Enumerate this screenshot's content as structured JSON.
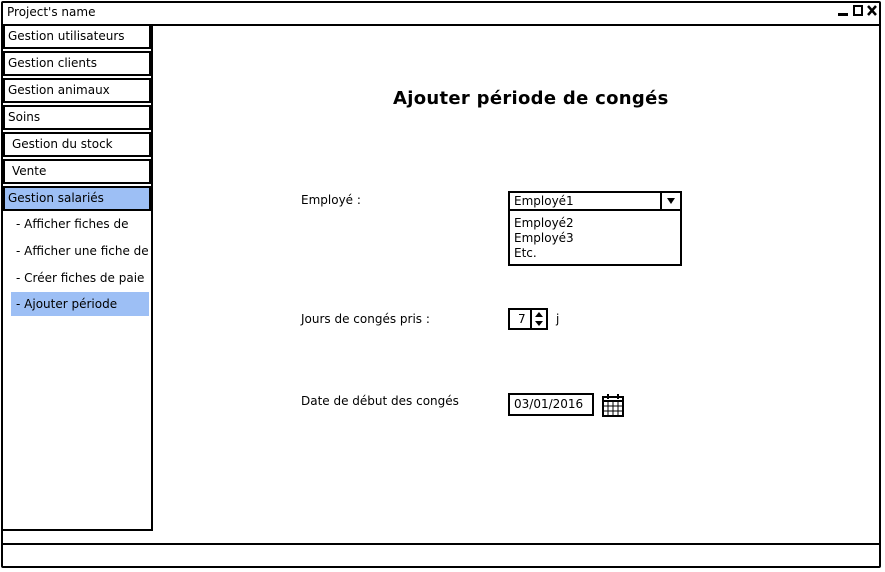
{
  "window": {
    "title": "Project's name",
    "controls": [
      "minimize-icon",
      "maximize-icon",
      "close-icon"
    ]
  },
  "sidebar": {
    "items": [
      {
        "label": "Gestion utilisateurs"
      },
      {
        "label": "Gestion clients"
      },
      {
        "label": "Gestion animaux"
      },
      {
        "label": "Soins"
      },
      {
        "label": "Gestion du stock"
      },
      {
        "label": "Vente"
      },
      {
        "label": "Gestion salariés"
      }
    ],
    "subitems": [
      {
        "label": "- Afficher fiches de"
      },
      {
        "label": "- Afficher une fiche de"
      },
      {
        "label": "- Créer fiches de paie"
      },
      {
        "label": "- Ajouter période"
      }
    ]
  },
  "main": {
    "title": "Ajouter période de congés",
    "employee_label": "Employé :",
    "employee_selected": "Employé1",
    "employee_options": [
      "Employé2",
      "Employé3",
      "Etc."
    ],
    "days_label": "Jours de congés pris :",
    "days_value": "7",
    "days_unit": "j",
    "date_label": "Date de début des congés",
    "date_value": "03/01/2016"
  },
  "colors": {
    "selection": "#9dbff5",
    "border": "#000000"
  }
}
